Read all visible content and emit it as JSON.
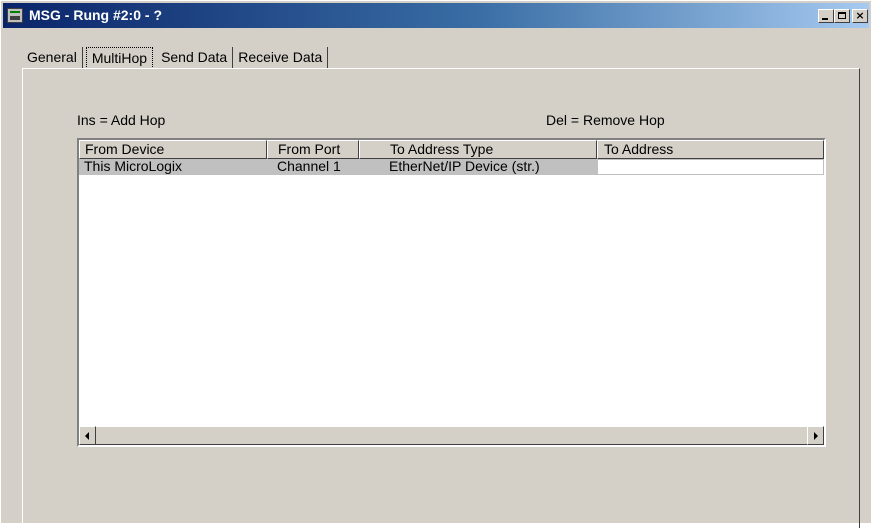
{
  "window": {
    "title": "MSG - Rung #2:0 - ?",
    "controls": {
      "minimize": "_",
      "maximize": "□",
      "close": "×"
    }
  },
  "tabs": [
    {
      "label": "General",
      "active": false
    },
    {
      "label": "MultiHop",
      "active": true
    },
    {
      "label": "Send Data",
      "active": false
    },
    {
      "label": "Receive Data",
      "active": false
    }
  ],
  "hints": {
    "insert": "Ins = Add Hop",
    "delete": "Del = Remove Hop"
  },
  "table": {
    "columns": [
      "From Device",
      "From Port",
      "To Address Type",
      "To Address"
    ],
    "rows": [
      [
        "This MicroLogix",
        "Channel  1",
        "EtherNet/IP Device (str.)",
        ""
      ]
    ]
  },
  "icons": {
    "app": "msg-app-icon",
    "scroll_left": "arrow-left-icon",
    "scroll_right": "arrow-right-icon"
  },
  "colors": {
    "titlebar_start": "#0a246a",
    "titlebar_end": "#a6caf0",
    "face": "#d4d0c8",
    "selected_row": "#c0c0c0"
  }
}
